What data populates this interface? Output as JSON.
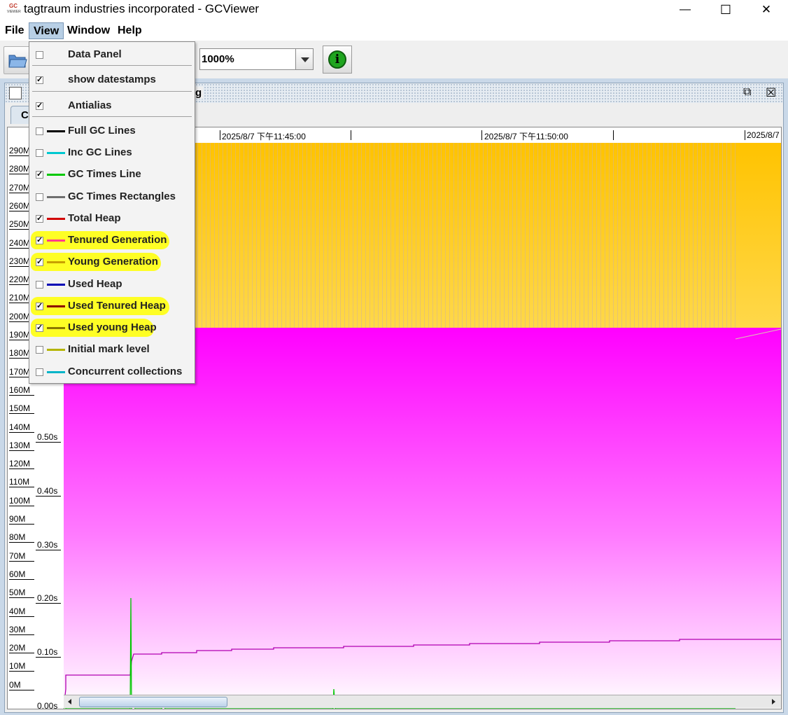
{
  "window": {
    "title": "tagtraum industries incorporated - GCViewer",
    "icon_top": "GC",
    "icon_bottom": "VIEWER",
    "minimize_glyph": "—",
    "maximize_glyph": "☐",
    "close_glyph": "✕"
  },
  "menubar": {
    "items": [
      {
        "label": "File"
      },
      {
        "label": "View"
      },
      {
        "label": "Window"
      },
      {
        "label": "Help"
      }
    ]
  },
  "toolbar": {
    "zoom_value": "1000%",
    "info_glyph": "i"
  },
  "document": {
    "title_fragment": "g",
    "tab_label": "Ch",
    "restore_glyph": "⧉",
    "close_glyph": "☒"
  },
  "timeline": {
    "stamps": [
      "2025/8/7 下午11:45:00",
      "2025/8/7 下午11:50:00",
      "2025/8/7"
    ]
  },
  "memory_axis": [
    "290M",
    "280M",
    "270M",
    "260M",
    "250M",
    "240M",
    "230M",
    "220M",
    "210M",
    "200M",
    "190M",
    "180M",
    "170M",
    "160M",
    "150M",
    "140M",
    "130M",
    "120M",
    "110M",
    "100M",
    "90M",
    "80M",
    "70M",
    "60M",
    "50M",
    "40M",
    "30M",
    "20M",
    "10M",
    "0M"
  ],
  "time_axis": [
    "0.50s",
    "0.40s",
    "0.30s",
    "0.20s",
    "0.10s",
    "0.00s"
  ],
  "view_menu": {
    "items": [
      {
        "label": "Data Panel",
        "checked": false,
        "swatch": null
      },
      {
        "label": "show datestamps",
        "checked": true,
        "swatch": null
      },
      {
        "label": "Antialias",
        "checked": true,
        "swatch": null
      },
      {
        "label": "Full GC Lines",
        "checked": false,
        "swatch": "#000000"
      },
      {
        "label": "Inc GC Lines",
        "checked": false,
        "swatch": "#00c8d0"
      },
      {
        "label": "GC Times Line",
        "checked": true,
        "swatch": "#00c800"
      },
      {
        "label": "GC Times Rectangles",
        "checked": false,
        "swatch": "#6e6e6e"
      },
      {
        "label": "Total Heap",
        "checked": true,
        "swatch": "#d20000"
      },
      {
        "label": "Tenured Generation",
        "checked": true,
        "swatch": "#ff3c8c"
      },
      {
        "label": "Young Generation",
        "checked": true,
        "swatch": "#c8a000"
      },
      {
        "label": "Used Heap",
        "checked": false,
        "swatch": "#0000b4"
      },
      {
        "label": "Used Tenured Heap",
        "checked": true,
        "swatch": "#8c0000"
      },
      {
        "label": "Used young Heap",
        "checked": true,
        "swatch": "#8c7800"
      },
      {
        "label": "Initial mark level",
        "checked": false,
        "swatch": "#b4b400"
      },
      {
        "label": "Concurrent collections",
        "checked": false,
        "swatch": "#00b4c8"
      }
    ]
  },
  "colors": {
    "young_generation_fill": "#ffc300",
    "tenured_generation_fill": "#ff00ff",
    "gc_times_line": "#00c800",
    "used_tenured_line": "#b000b0",
    "highlight": "#ffff00"
  }
}
